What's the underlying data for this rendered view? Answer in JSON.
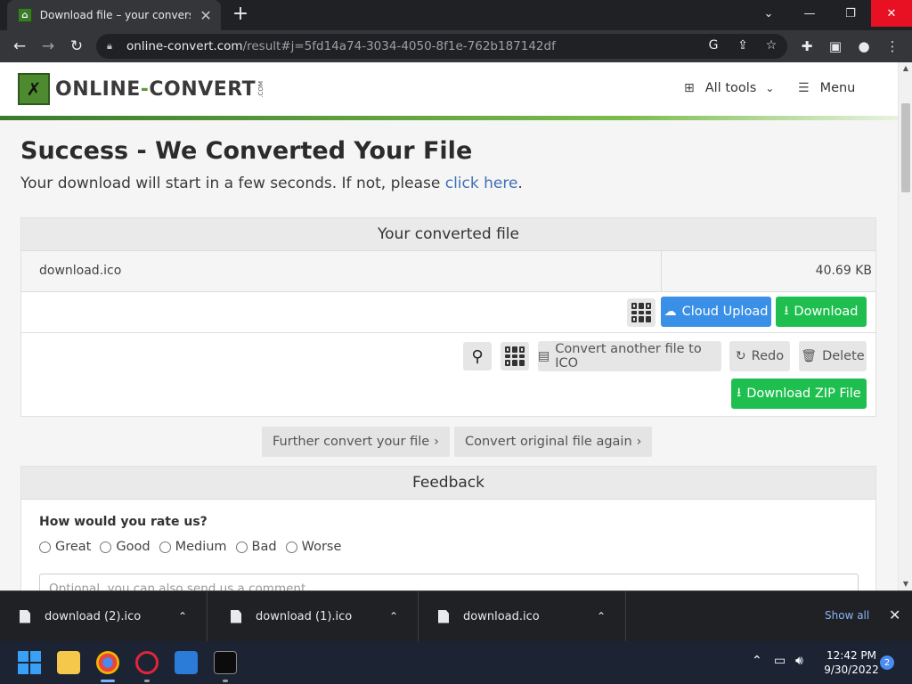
{
  "browser": {
    "tab_title": "Download file – your conversion",
    "url_host": "online-convert.com",
    "url_path": "/result#j=5fd14a74-3034-4050-8f1e-762b187142df"
  },
  "site": {
    "logo_text_a": "ONLINE",
    "logo_text_dash": "-",
    "logo_text_b": "CONVERT",
    "logo_com": ".COM",
    "nav_all_tools": "All tools",
    "nav_menu": "Menu"
  },
  "page": {
    "title": "Success - We Converted Your File",
    "subtitle_prefix": "Your download will start in a few seconds. If not, please ",
    "subtitle_link": "click here",
    "subtitle_suffix": "."
  },
  "converted": {
    "heading": "Your converted file",
    "file_name": "download.ico",
    "file_size": "40.69 KB",
    "cloud_upload": "Cloud Upload",
    "download": "Download",
    "convert_another": "Convert another file to ICO",
    "redo": "Redo",
    "delete": "Delete",
    "download_zip": "Download ZIP File"
  },
  "secondary": {
    "further_convert": "Further convert your file",
    "convert_again": "Convert original file again"
  },
  "feedback": {
    "heading": "Feedback",
    "question": "How would you rate us?",
    "options": [
      "Great",
      "Good",
      "Medium",
      "Bad",
      "Worse"
    ],
    "comment_placeholder": "Optional, you can also send us a comment."
  },
  "downloads": {
    "items": [
      "download (2).ico",
      "download (1).ico",
      "download.ico"
    ],
    "show_all": "Show all"
  },
  "taskbar": {
    "time": "12:42 PM",
    "date": "9/30/2022",
    "notification_count": "2"
  }
}
